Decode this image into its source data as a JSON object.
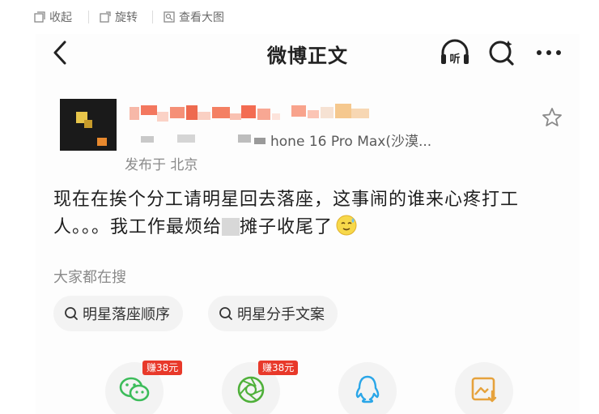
{
  "viewer": {
    "collapse": "收起",
    "rotate": "旋转",
    "view_large": "查看大图"
  },
  "nav": {
    "title": "微博正文",
    "listen_label": "听"
  },
  "post": {
    "device": "hone 16 Pro Max(沙漠...",
    "location": "发布于 北京",
    "content_line1": "现在在挨个分工请明星回去落座，这事闹的谁来心疼打工",
    "content_line2": "人。。。我工作最烦给",
    "content_line2b": "摊子收尾了"
  },
  "search": {
    "label": "大家都在搜",
    "chips": [
      "明星落座顺序",
      "明星分手文案"
    ]
  },
  "share": {
    "badges": [
      "赚38元",
      "赚38元"
    ]
  },
  "colors": {
    "wechat": "#3cbc5a",
    "moments": "#4fb03a",
    "qq": "#2aa6e8",
    "save": "#e6a23c",
    "badge": "#e8392a"
  }
}
